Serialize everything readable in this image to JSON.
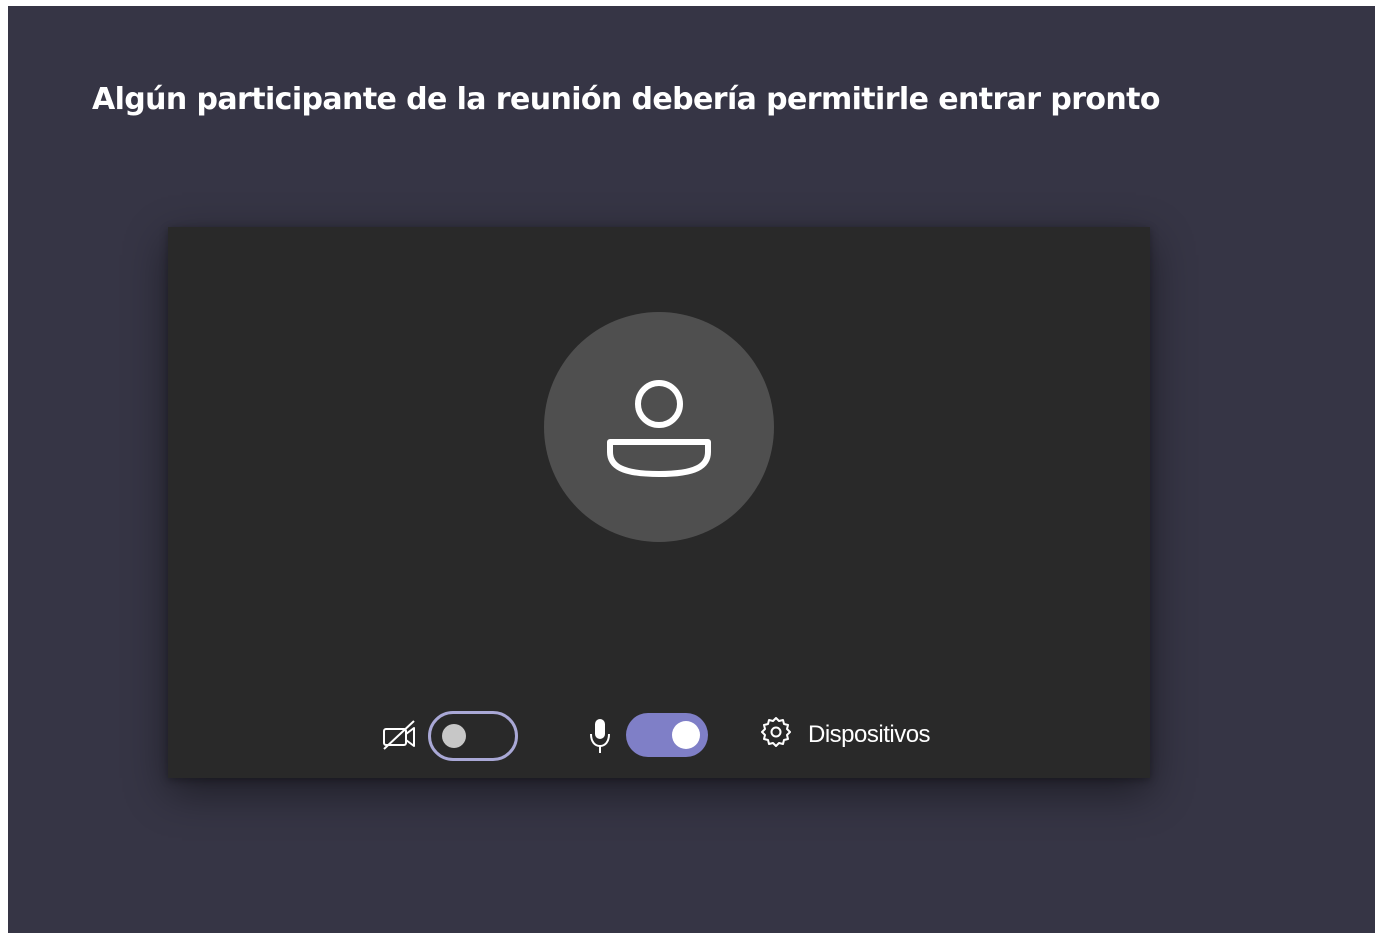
{
  "lobby": {
    "heading": "Algún participante de la reunión debería permitirle entrar pronto"
  },
  "preview": {
    "avatar_icon": "person-icon",
    "background_color": "#292929"
  },
  "controls": {
    "camera": {
      "icon": "video-off-icon",
      "enabled": false
    },
    "microphone": {
      "icon": "microphone-icon",
      "enabled": true
    },
    "devices": {
      "icon": "gear-icon",
      "label": "Dispositivos"
    },
    "accent_color": "#7f7fc7"
  }
}
